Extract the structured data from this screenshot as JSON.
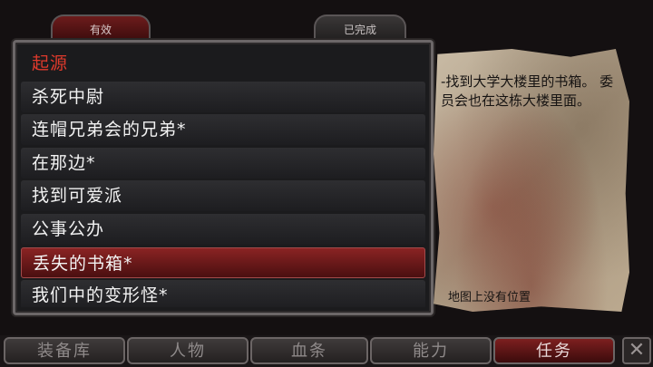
{
  "tabs": {
    "active": "有效",
    "completed": "已完成"
  },
  "quests": [
    {
      "label": "起源",
      "type": "header"
    },
    {
      "label": "杀死中尉"
    },
    {
      "label": "连帽兄弟会的兄弟*"
    },
    {
      "label": "在那边*"
    },
    {
      "label": "找到可爱派"
    },
    {
      "label": "公事公办"
    },
    {
      "label": "丢失的书箱*",
      "selected": true
    },
    {
      "label": "我们中的变形怪*"
    }
  ],
  "detail": {
    "text": "-找到大学大楼里的书箱。 委员会也在这栋大楼里面。",
    "footer": "地图上没有位置"
  },
  "bottom_tabs": [
    "装备库",
    "人物",
    "血条",
    "能力",
    "任务"
  ],
  "active_bottom_tab": "任务",
  "close_icon": "close-icon"
}
